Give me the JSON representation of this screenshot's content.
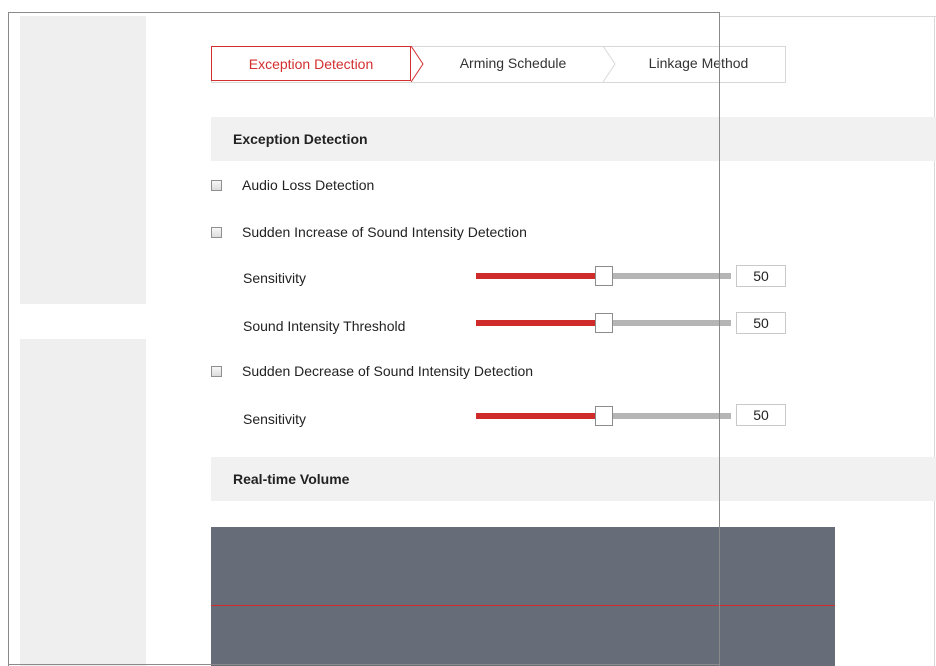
{
  "tabs": [
    {
      "label": "Exception Detection",
      "active": true
    },
    {
      "label": "Arming Schedule",
      "active": false
    },
    {
      "label": "Linkage Method",
      "active": false
    }
  ],
  "sections": {
    "exception_detection": "Exception Detection",
    "real_time_volume": "Real-time Volume"
  },
  "options": {
    "audio_loss": {
      "label": "Audio Loss Detection",
      "checked": false
    },
    "sudden_increase": {
      "label": "Sudden Increase of Sound Intensity Detection",
      "checked": false
    },
    "sudden_decrease": {
      "label": "Sudden Decrease of Sound Intensity Detection",
      "checked": false
    }
  },
  "sliders": {
    "increase_sensitivity": {
      "label": "Sensitivity",
      "value": "50",
      "level": 0.5
    },
    "threshold": {
      "label": "Sound Intensity Threshold",
      "value": "50",
      "level": 0.5
    },
    "decrease_sensitivity": {
      "label": "Sensitivity",
      "value": "50",
      "level": 0.5
    }
  },
  "colors": {
    "accent": "#d32f2f",
    "panel": "#f1f1f1",
    "volume_background": "#676d78",
    "slider_fill": "#cf2b2b",
    "slider_rest": "#b5b5b5"
  }
}
